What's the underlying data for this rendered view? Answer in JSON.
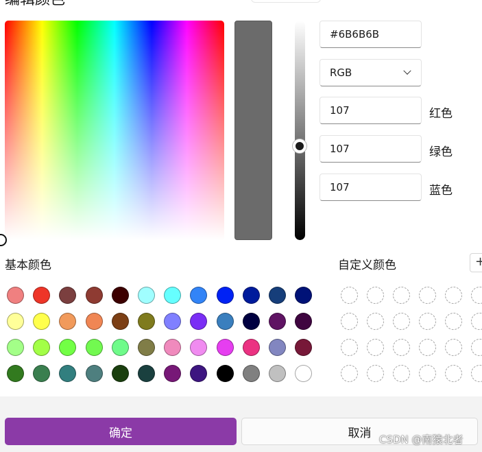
{
  "dialog": {
    "title": "编辑颜色"
  },
  "picker": {
    "preview_color": "#6B6B6B"
  },
  "fields": {
    "hex_value": "#6B6B6B",
    "mode": "RGB",
    "red_value": "107",
    "red_label": "红色",
    "green_value": "107",
    "green_label": "绿色",
    "blue_value": "107",
    "blue_label": "蓝色"
  },
  "basic_colors": {
    "label": "基本颜色",
    "colors": [
      "#F08080",
      "#EE3528",
      "#7B3F3F",
      "#8E3B32",
      "#3D0000",
      "#A0FEFF",
      "#66FFFF",
      "#3284F7",
      "#0022F5",
      "#001B9C",
      "#163E7A",
      "#001277",
      "#FFFF99",
      "#FFFF4C",
      "#F19A5B",
      "#F08654",
      "#7C3F15",
      "#7F7B1D",
      "#8080FF",
      "#7A2EF5",
      "#3A7FBE",
      "#000040",
      "#5F1363",
      "#3F0540",
      "#A3FF88",
      "#A3FF47",
      "#72FF45",
      "#72F950",
      "#6FFB8A",
      "#807D47",
      "#F08ABD",
      "#F08BF0",
      "#E63EF0",
      "#EB3282",
      "#8286C0",
      "#771838",
      "#327A1F",
      "#3A7F4F",
      "#327F7F",
      "#4E7F7F",
      "#1A3F0E",
      "#1A403F",
      "#771877",
      "#3D1580",
      "#000000",
      "#808080",
      "#C0C0C0",
      "#FFFFFF"
    ]
  },
  "custom_colors": {
    "label": "自定义颜色",
    "add_label": "+"
  },
  "buttons": {
    "ok": "确定",
    "cancel": "取消"
  },
  "watermark": "CSDN @南猿北者"
}
